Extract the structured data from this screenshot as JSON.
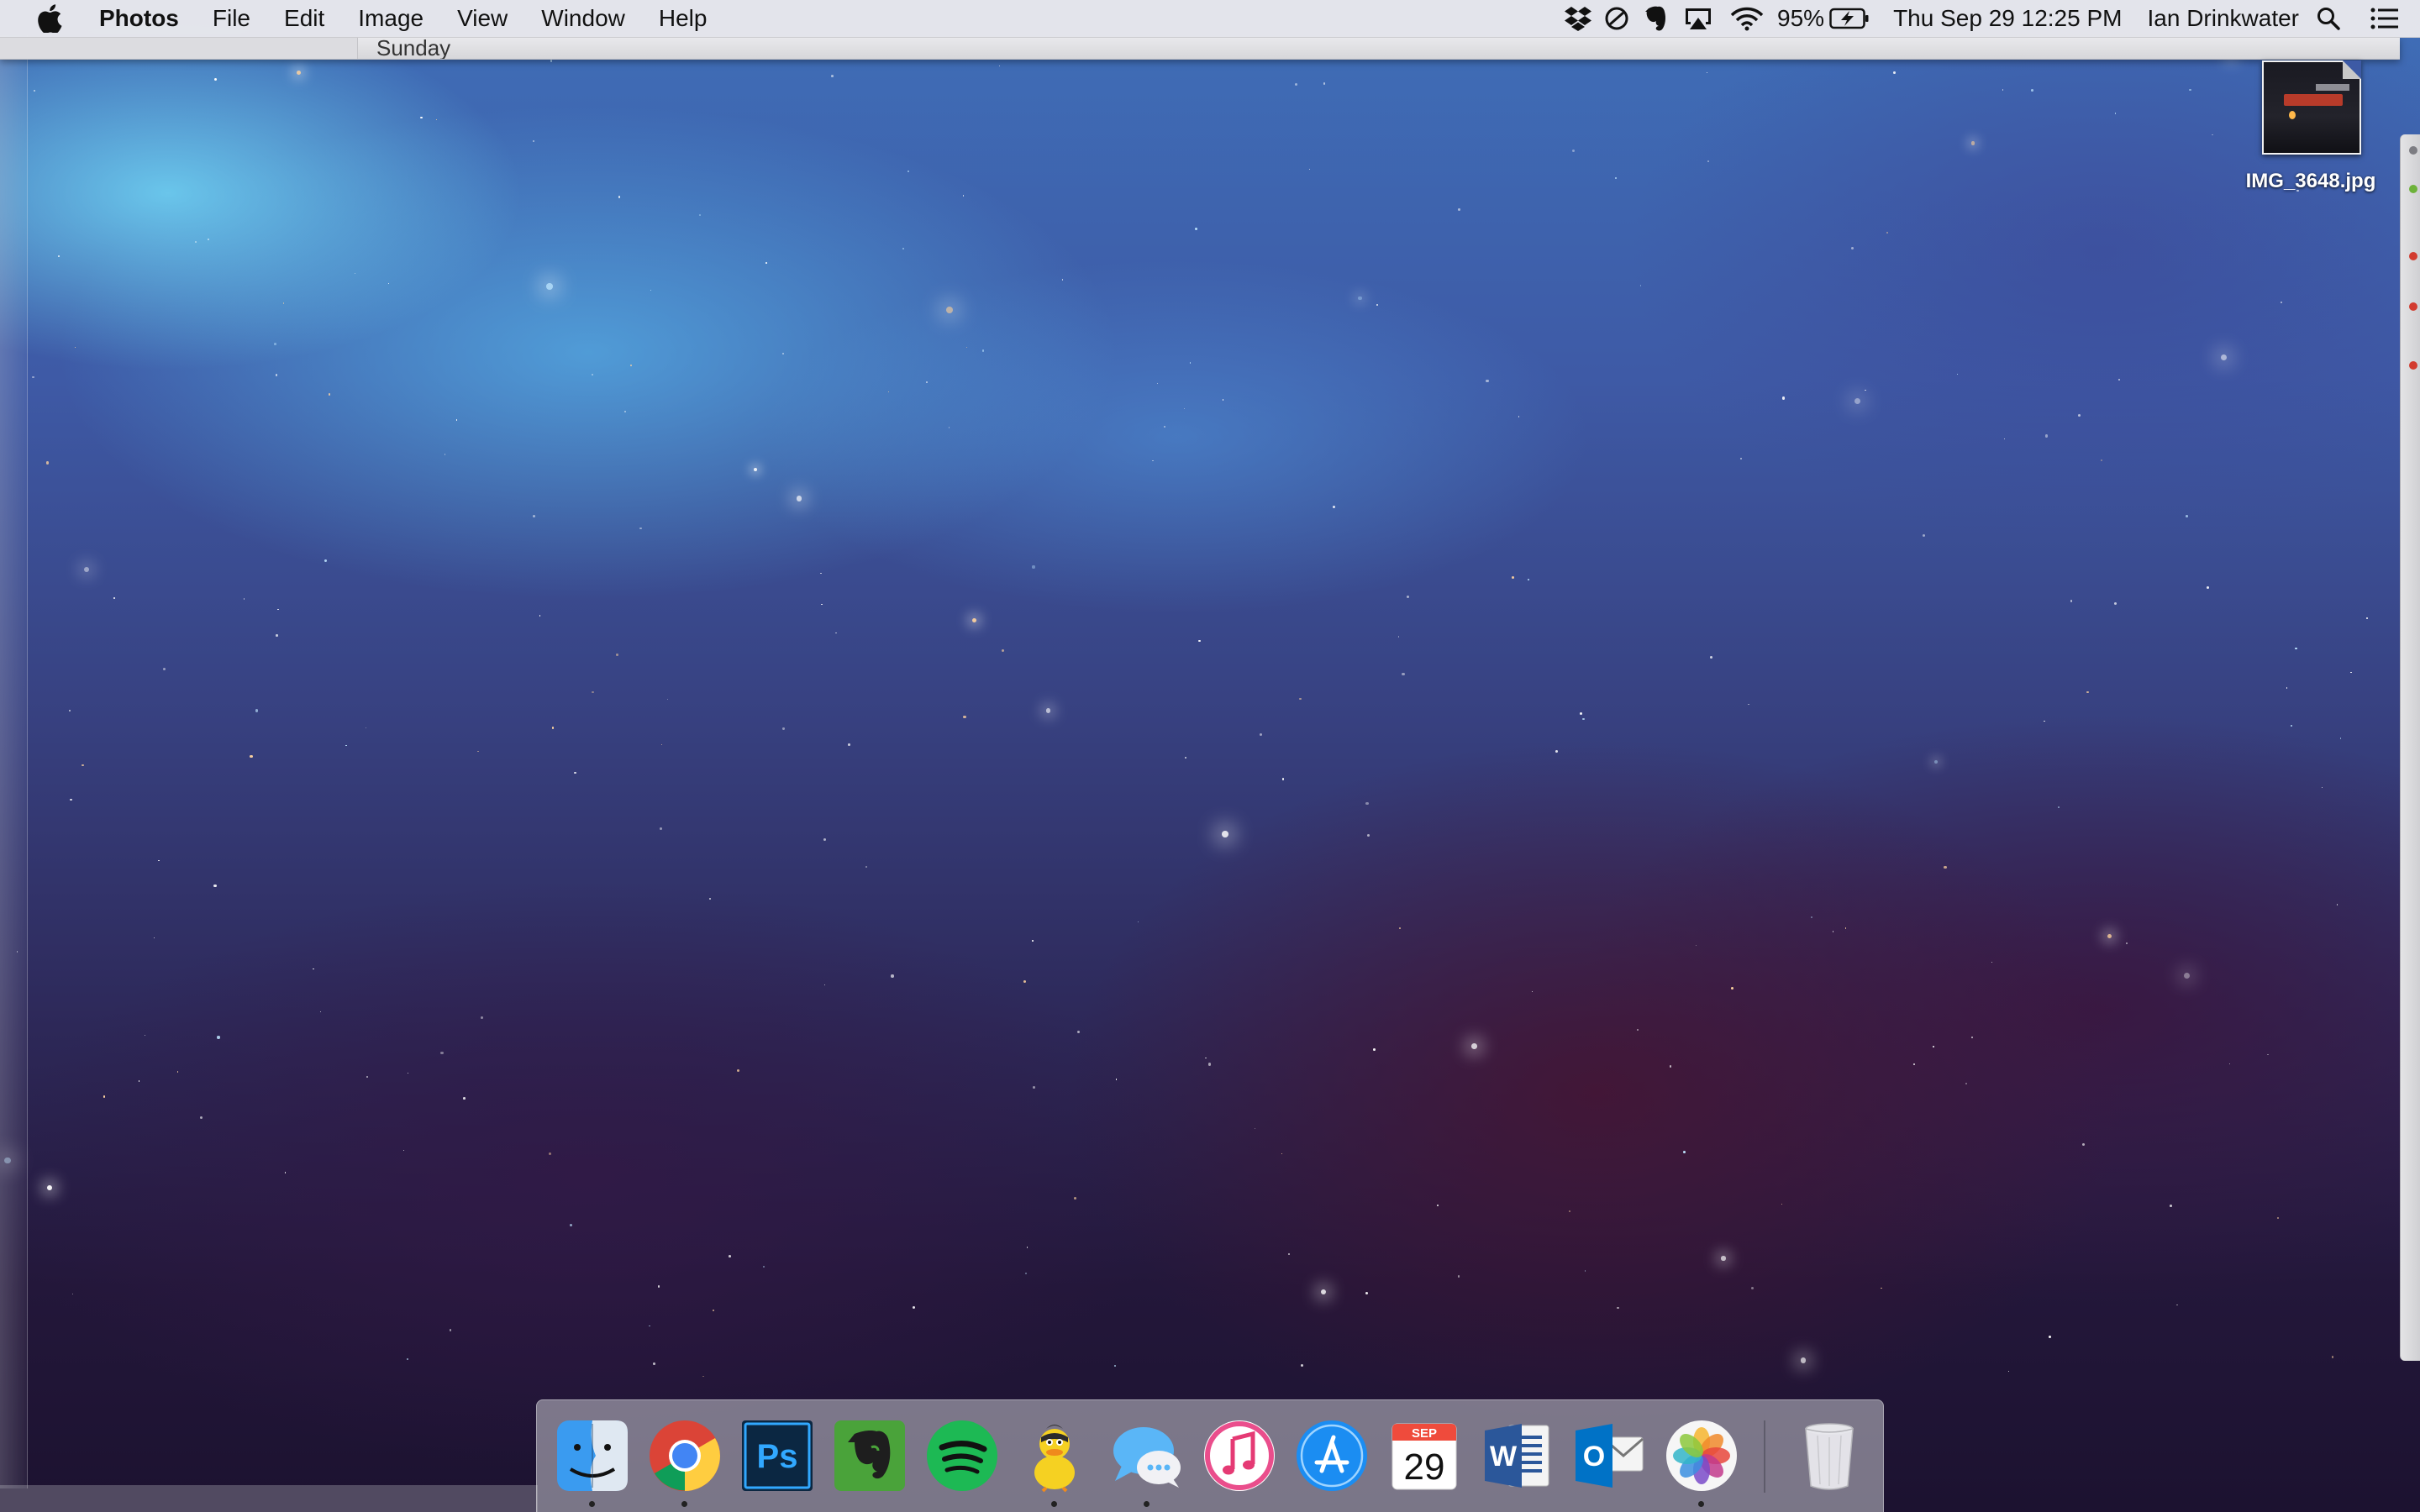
{
  "menubar": {
    "app_name": "Photos",
    "menus": [
      "File",
      "Edit",
      "Image",
      "View",
      "Window",
      "Help"
    ],
    "status": {
      "battery_percent": "95%",
      "datetime": "Thu Sep 29  12:25 PM",
      "user_name": "Ian Drinkwater"
    },
    "status_icons": [
      "dropbox-icon",
      "do-not-disturb-icon",
      "evernote-icon",
      "airplay-icon",
      "wifi-icon",
      "battery-charging-icon",
      "spotlight-search-icon",
      "notification-center-icon"
    ]
  },
  "background_window": {
    "title": "Sunday"
  },
  "desktop": {
    "file": {
      "name": "IMG_3648.jpg"
    }
  },
  "dock": {
    "apps": [
      {
        "name": "Finder",
        "icon": "finder-icon",
        "running": true
      },
      {
        "name": "Google Chrome",
        "icon": "chrome-icon",
        "running": true
      },
      {
        "name": "Photoshop",
        "icon": "photoshop-icon",
        "label": "Ps",
        "running": false
      },
      {
        "name": "Evernote",
        "icon": "evernote-icon",
        "running": false
      },
      {
        "name": "Spotify",
        "icon": "spotify-icon",
        "running": false
      },
      {
        "name": "Cyberduck",
        "icon": "cyberduck-icon",
        "running": true
      },
      {
        "name": "Messages",
        "icon": "messages-icon",
        "running": true
      },
      {
        "name": "iTunes",
        "icon": "itunes-icon",
        "running": false
      },
      {
        "name": "App Store",
        "icon": "app-store-icon",
        "running": false
      },
      {
        "name": "Calendar",
        "icon": "calendar-icon",
        "month": "SEP",
        "day": "29",
        "running": false
      },
      {
        "name": "Microsoft Word",
        "icon": "word-icon",
        "label": "W",
        "running": false
      },
      {
        "name": "Microsoft Outlook",
        "icon": "outlook-icon",
        "label": "O",
        "running": false
      },
      {
        "name": "Photos",
        "icon": "photos-icon",
        "running": true
      },
      {
        "name": "Trash",
        "icon": "trash-icon",
        "running": false
      }
    ]
  }
}
